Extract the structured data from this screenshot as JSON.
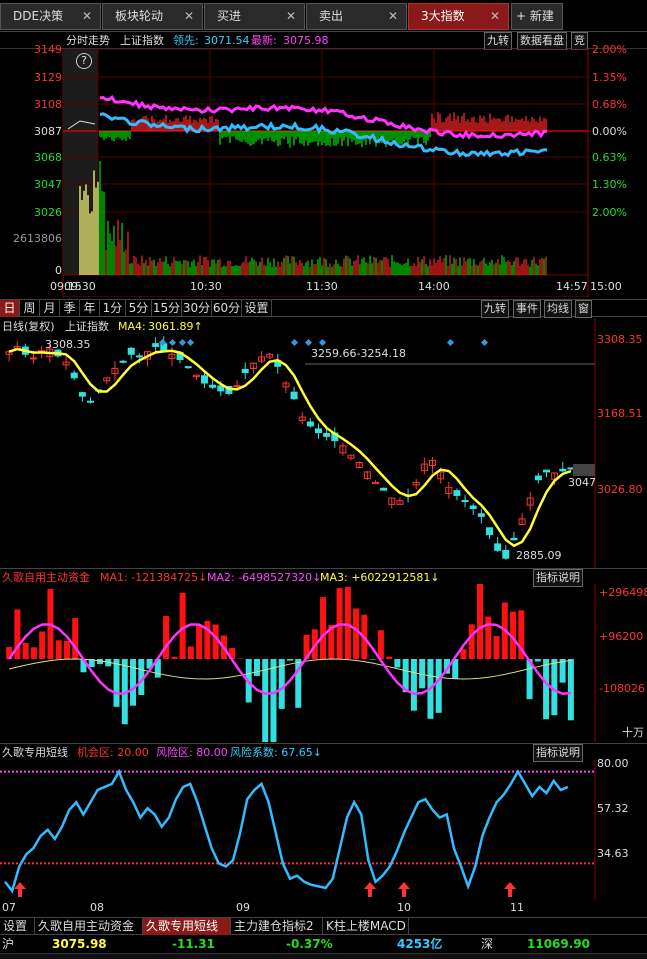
{
  "tabs": [
    {
      "label": "DDE决策",
      "active": false
    },
    {
      "label": "板块轮动",
      "active": false
    },
    {
      "label": "买进",
      "active": false
    },
    {
      "label": "卖出",
      "active": false
    },
    {
      "label": "3大指数",
      "active": true
    }
  ],
  "new_tab_label": "+ 新建",
  "intraday": {
    "title": "分时走势",
    "index": "上证指数",
    "lead_label": "领先:",
    "lead_value": "3071.54",
    "latest_label": "最新:",
    "latest_value": "3075.98",
    "buttons": [
      "九转",
      "数据看盘",
      "竞"
    ],
    "price_ticks": [
      "3149",
      "3129",
      "3108",
      "3087",
      "3068",
      "3047",
      "3026"
    ],
    "pct_ticks": [
      "2.00%",
      "1.35%",
      "0.68%",
      "0.00%",
      "0.63%",
      "1.30%",
      "2.00%"
    ],
    "volume_tick": "2613806",
    "volume_zero": "0",
    "time_ticks": [
      "09:15",
      "09:30",
      "10:30",
      "11:30",
      "14:00",
      "14:57",
      "15:00"
    ]
  },
  "periods": [
    "日",
    "周",
    "月",
    "季",
    "年",
    "1分",
    "5分",
    "15分",
    "30分",
    "60分",
    "设置"
  ],
  "selected_period": "日",
  "kline_buttons": [
    "九转",
    "事件",
    "均线",
    "窗"
  ],
  "kline": {
    "title": "日线(复权)",
    "index": "上证指数",
    "ma_label": "MA4:",
    "ma_value": "3061.89↑",
    "price_ticks": [
      "3308.35",
      "3168.51",
      "3026.80"
    ],
    "high_label": "3308.35",
    "range_label": "3259.66-3254.18",
    "low_label": "2885.09",
    "last_label": "3047"
  },
  "capital": {
    "title": "久歌自用主动资金",
    "ma1": "MA1: -121384725↓",
    "ma2": "MA2: -6498527320↓",
    "ma3": "MA3: +6022912581↓",
    "button": "指标说明",
    "ticks": [
      "+296498",
      "+96200",
      "-108026"
    ],
    "unit": "十万"
  },
  "shortline": {
    "title": "久歌专用短线",
    "chance": "机会区: 20.00",
    "risk": "风险区: 80.00",
    "coef": "风险系数: 67.65↓",
    "button": "指标说明",
    "ticks": [
      "80.00",
      "57.32",
      "34.63"
    ]
  },
  "date_ticks": [
    "07",
    "08",
    "09",
    "10",
    "11"
  ],
  "bottom_tabs": [
    "设置",
    "久歌自用主动资金",
    "久歌专用短线",
    "主力建仓指标2",
    "K柱上楼MACD"
  ],
  "selected_bottom_tab": "久歌专用短线",
  "status": {
    "market": "沪",
    "price": "3075.98",
    "change": "-11.31",
    "pct": "-0.37%",
    "amount": "4253亿",
    "market2": "深",
    "price2": "11069.90"
  },
  "colors": {
    "up": "#ff3333",
    "down": "#33e0e0",
    "ma": "#ffff33",
    "magenta": "#ff44ff",
    "blue": "#33bbff",
    "active_tab": "#8a1a1a"
  },
  "chart_data": {
    "type": "line",
    "shortline_values": [
      8,
      2,
      18,
      26,
      30,
      38,
      42,
      36,
      44,
      55,
      60,
      52,
      60,
      68,
      70,
      72,
      80,
      68,
      60,
      50,
      56,
      52,
      44,
      50,
      62,
      70,
      72,
      60,
      45,
      30,
      20,
      18,
      22,
      40,
      62,
      68,
      72,
      60,
      40,
      20,
      10,
      12,
      8,
      6,
      5,
      4,
      10,
      30,
      50,
      60,
      52,
      22,
      8,
      12,
      18,
      28,
      40,
      50,
      60,
      62,
      55,
      50,
      52,
      30,
      18,
      5,
      18,
      38,
      50,
      60,
      65,
      72,
      80,
      72,
      64,
      70,
      66,
      74,
      68,
      70
    ],
    "shortline_ylim": [
      0,
      85
    ],
    "kline_close": [
      3290,
      3300,
      3285,
      3278,
      3292,
      3295,
      3282,
      3270,
      3240,
      3205,
      3195,
      3215,
      3240,
      3258,
      3270,
      3285,
      3280,
      3290,
      3300,
      3292,
      3285,
      3275,
      3260,
      3245,
      3230,
      3222,
      3215,
      3210,
      3225,
      3250,
      3268,
      3280,
      3285,
      3262,
      3230,
      3200,
      3165,
      3148,
      3135,
      3128,
      3120,
      3110,
      3092,
      3078,
      3060,
      3040,
      3025,
      3010,
      3005,
      3015,
      3040,
      3075,
      3082,
      3060,
      3030,
      3015,
      3005,
      2990,
      2975,
      2940,
      2910,
      2895,
      2930,
      2970,
      3010,
      3045,
      3060,
      3058,
      3062,
      3066
    ],
    "kline_ylim": [
      2880,
      3320
    ]
  }
}
